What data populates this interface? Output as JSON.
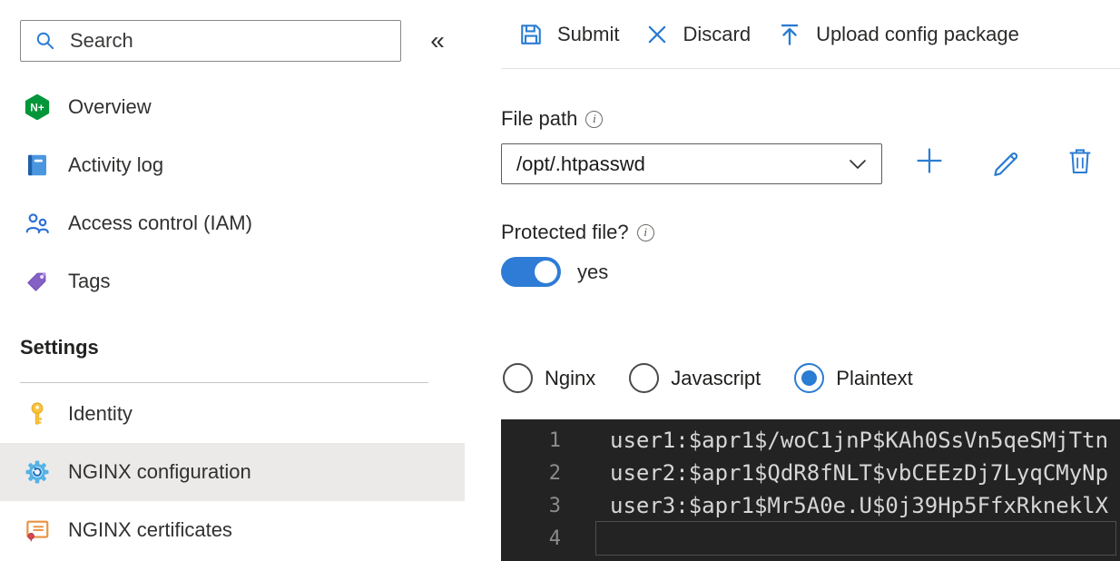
{
  "sidebar": {
    "search": {
      "placeholder": "Search",
      "collapse_glyph": "«"
    },
    "items": [
      {
        "label": "Overview",
        "icon": "nginx-logo"
      },
      {
        "label": "Activity log",
        "icon": "activity-log"
      },
      {
        "label": "Access control (IAM)",
        "icon": "people"
      },
      {
        "label": "Tags",
        "icon": "tag"
      }
    ],
    "settings_header": "Settings",
    "settings_items": [
      {
        "label": "Identity",
        "icon": "key",
        "selected": false
      },
      {
        "label": "NGINX configuration",
        "icon": "gear",
        "selected": true
      },
      {
        "label": "NGINX certificates",
        "icon": "certificate",
        "selected": false
      }
    ]
  },
  "toolbar": {
    "submit_label": "Submit",
    "discard_label": "Discard",
    "upload_label": "Upload config package"
  },
  "file_path": {
    "label": "File path",
    "value": "/opt/.htpasswd"
  },
  "protected_file": {
    "label": "Protected file?",
    "state_label": "yes",
    "enabled": true
  },
  "syntax_options": [
    {
      "label": "Nginx",
      "selected": false
    },
    {
      "label": "Javascript",
      "selected": false
    },
    {
      "label": "Plaintext",
      "selected": true
    }
  ],
  "editor": {
    "lines": [
      {
        "number": "1",
        "text": "user1:$apr1$/woC1jnP$KAh0SsVn5qeSMjTtn"
      },
      {
        "number": "2",
        "text": "user2:$apr1$QdR8fNLT$vbCEEzDj7LyqCMyNp"
      },
      {
        "number": "3",
        "text": "user3:$apr1$Mr5A0e.U$0j39Hp5FfxRkneklX"
      },
      {
        "number": "4",
        "text": ""
      }
    ]
  },
  "colors": {
    "accent_blue": "#2b7cd3",
    "toggle_on": "#2e7cd6",
    "nginx_green": "#009639",
    "selected_row_bg": "#ebeae8",
    "editor_bg": "#232323",
    "editor_text": "#d6d6d6",
    "editor_line_number": "#8b8b8b",
    "tag_purple": "#8661c5",
    "key_yellow": "#fcc23c"
  }
}
